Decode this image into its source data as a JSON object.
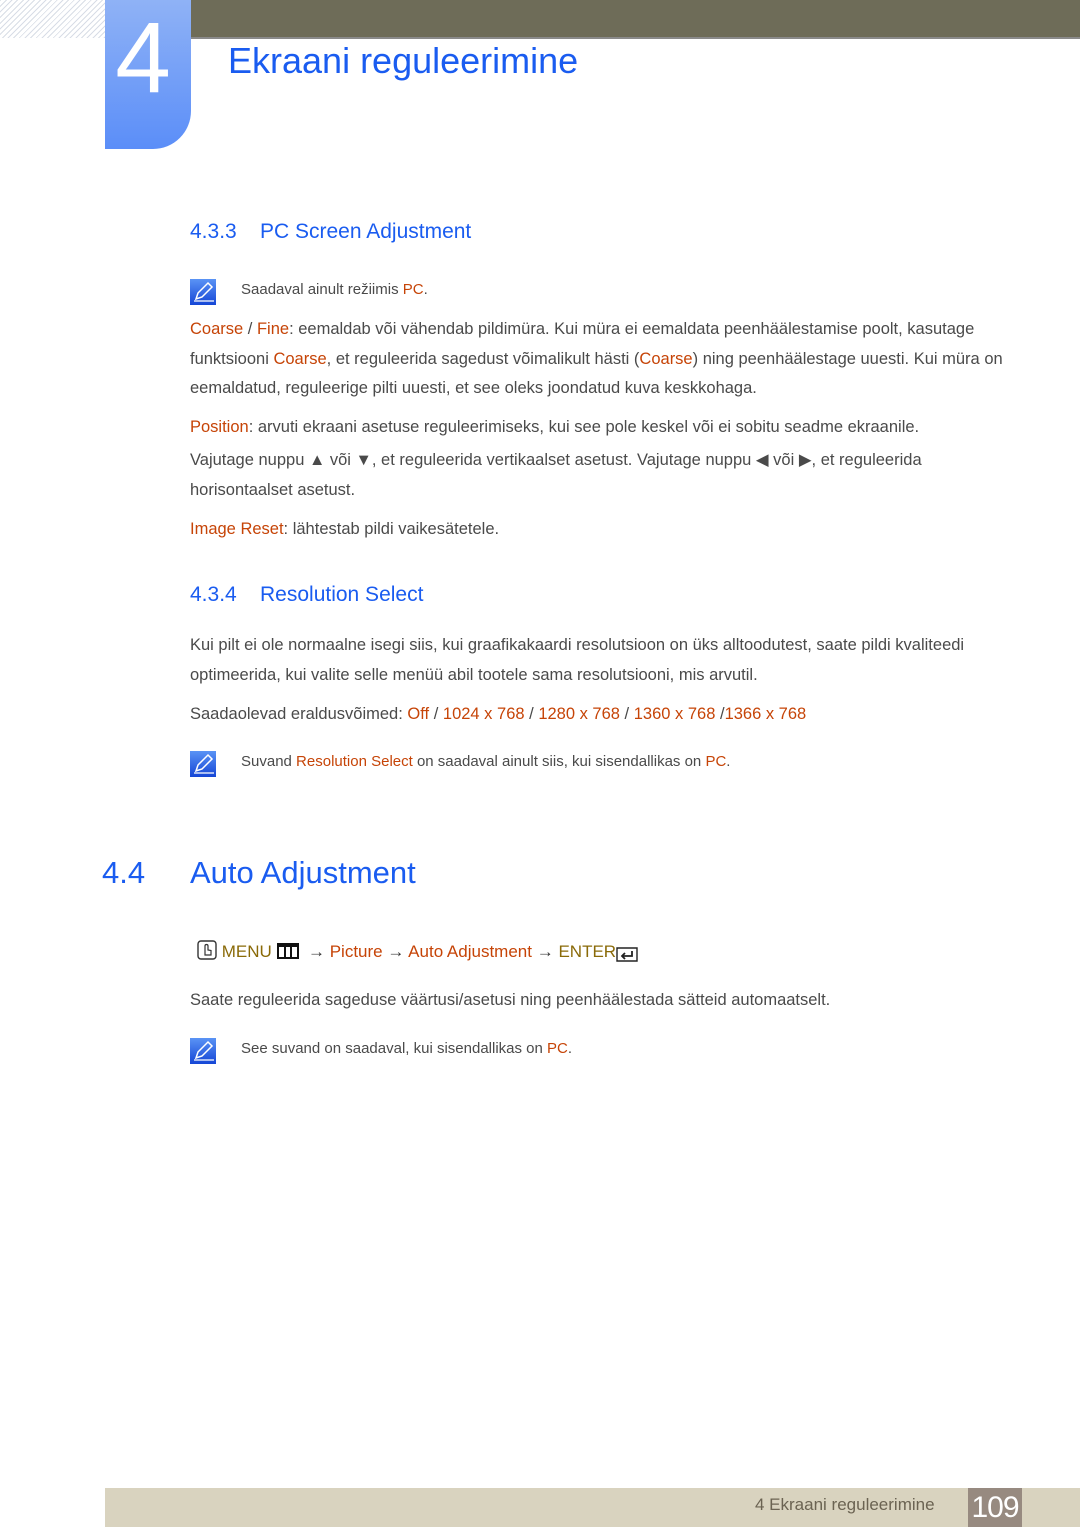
{
  "header": {
    "chapter_number": "4",
    "chapter_title": "Ekraani reguleerimine"
  },
  "section_433": {
    "number": "4.3.3",
    "title": "PC Screen Adjustment",
    "note": {
      "prefix": "Saadaval ainult režiimis ",
      "highlight": "PC",
      "suffix": "."
    },
    "coarse_fine": {
      "term1": "Coarse",
      "sep": " / ",
      "term2": "Fine",
      "text1": ": eemaldab või vähendab pildimüra. Kui müra ei eemaldata peenhäälestamise poolt, kasutage funktsiooni ",
      "term3": "Coarse",
      "text2": ", et reguleerida sagedust võimalikult hästi (",
      "term4": "Coarse",
      "text3": ") ning peenhäälestage uuesti. Kui müra on eemaldatud, reguleerige pilti uuesti, et see oleks joondatud kuva keskkohaga."
    },
    "position": {
      "term": "Position",
      "text": ": arvuti ekraani asetuse reguleerimiseks, kui see pole keskel või ei sobitu seadme ekraanile."
    },
    "arrows_text": "Vajutage nuppu ▲ või ▼, et reguleerida vertikaalset asetust. Vajutage nuppu ◀ või ▶, et reguleerida horisontaalset asetust.",
    "image_reset": {
      "term": "Image Reset",
      "text": ": lähtestab pildi vaikesätetele."
    }
  },
  "section_434": {
    "number": "4.3.4",
    "title": "Resolution Select",
    "body": "Kui pilt ei ole normaalne isegi siis, kui graafikakaardi resolutsioon on üks alltoodutest, saate pildi kvaliteedi optimeerida, kui valite selle menüü abil tootele sama resolutsiooni, mis arvutil.",
    "resolutions_label": "Saadaolevad eraldusvõimed: ",
    "resolutions": [
      "Off",
      "1024 x 768",
      "1280 x 768",
      "1360 x 768",
      "1366 x 768"
    ],
    "note": {
      "prefix": "Suvand ",
      "highlight1": "Resolution Select",
      "middle": " on saadaval ainult siis, kui sisendallikas on ",
      "highlight2": "PC",
      "suffix": "."
    }
  },
  "section_44": {
    "number": "4.4",
    "title": "Auto Adjustment",
    "menu_path": {
      "menu": "MENU",
      "arrow": "→",
      "step1": "Picture",
      "step2": "Auto Adjustment",
      "enter": "ENTER"
    },
    "body": "Saate reguleerida sageduse väärtusi/asetusi ning peenhäälestada sätteid automaatselt.",
    "note": {
      "prefix": "See suvand on saadaval, kui sisendallikas on ",
      "highlight": "PC",
      "suffix": "."
    }
  },
  "footer": {
    "chapter_label": "4 Ekraani reguleerimine",
    "page_number": "109"
  }
}
